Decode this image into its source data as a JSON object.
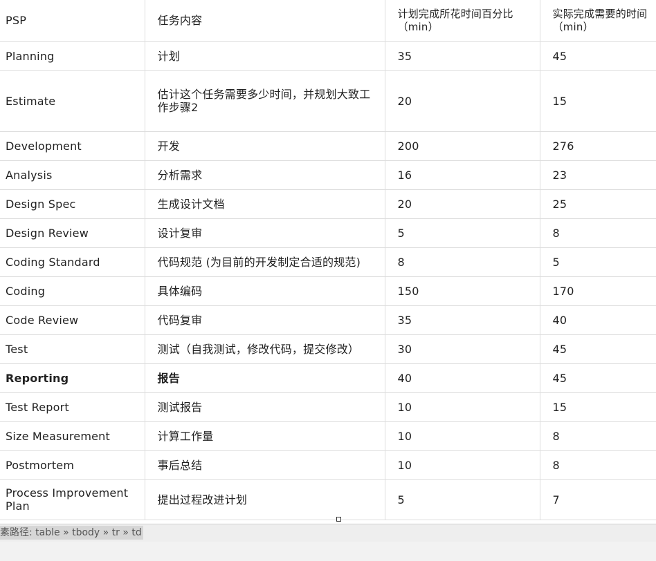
{
  "table": {
    "header": [
      "PSP",
      "任务内容",
      "计划完成所花时间百分比（min）",
      "实际完成需要的时间（min）"
    ],
    "rows": [
      {
        "psp": "Planning",
        "task": "计划",
        "planned": "35",
        "actual": "45"
      },
      {
        "psp": "Estimate",
        "task": "估计这个任务需要多少时间，并规划大致工作步骤2",
        "planned": "20",
        "actual": "15"
      },
      {
        "psp": "Development",
        "task": "开发",
        "planned": "200",
        "actual": "276"
      },
      {
        "psp": "Analysis",
        "task": "分析需求",
        "planned": "16",
        "actual": "23"
      },
      {
        "psp": "Design Spec",
        "task": "生成设计文档",
        "planned": "20",
        "actual": "25"
      },
      {
        "psp": "Design Review",
        "task": "设计复审",
        "planned": "5",
        "actual": "8"
      },
      {
        "psp": "Coding Standard",
        "task": "代码规范 (为目前的开发制定合适的规范)",
        "planned": "8",
        "actual": "5"
      },
      {
        "psp": "Coding",
        "task": "具体编码",
        "planned": "150",
        "actual": "170"
      },
      {
        "psp": "Code Review",
        "task": "代码复审",
        "planned": "35",
        "actual": "40"
      },
      {
        "psp": "Test",
        "task": "测试（自我测试，修改代码，提交修改）",
        "planned": "30",
        "actual": "45"
      },
      {
        "psp": "Reporting",
        "task": "报告",
        "planned": "40",
        "actual": "45"
      },
      {
        "psp": "Test Report",
        "task": "测试报告",
        "planned": "10",
        "actual": "15"
      },
      {
        "psp": "Size Measurement",
        "task": "计算工作量",
        "planned": "10",
        "actual": "8"
      },
      {
        "psp": "Postmortem",
        "task": "事后总结",
        "planned": "10",
        "actual": "8"
      },
      {
        "psp": "Process Improvement Plan",
        "task": "提出过程改进计划",
        "planned": "5",
        "actual": "7"
      }
    ]
  },
  "status_bar": {
    "element_path": "素路径: table » tbody » tr » td"
  }
}
